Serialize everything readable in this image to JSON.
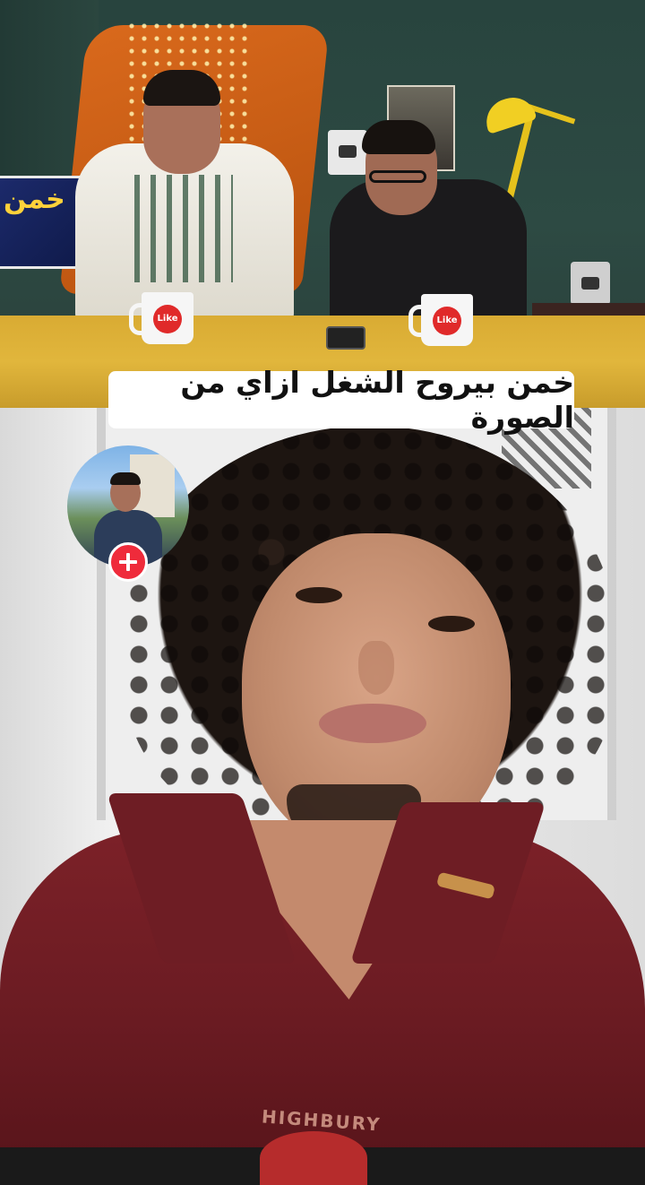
{
  "video": {
    "caption": "خمن بيروح الشغل ازاي من الصورة",
    "tv_text": "خمن",
    "mug_label": "Like",
    "shirt_text": "HIGHBURY"
  },
  "creator": {
    "follow_icon": "plus-icon"
  },
  "colors": {
    "follow_button": "#ef2b3b",
    "caption_bg": "#ffffff",
    "caption_text": "#111111"
  }
}
